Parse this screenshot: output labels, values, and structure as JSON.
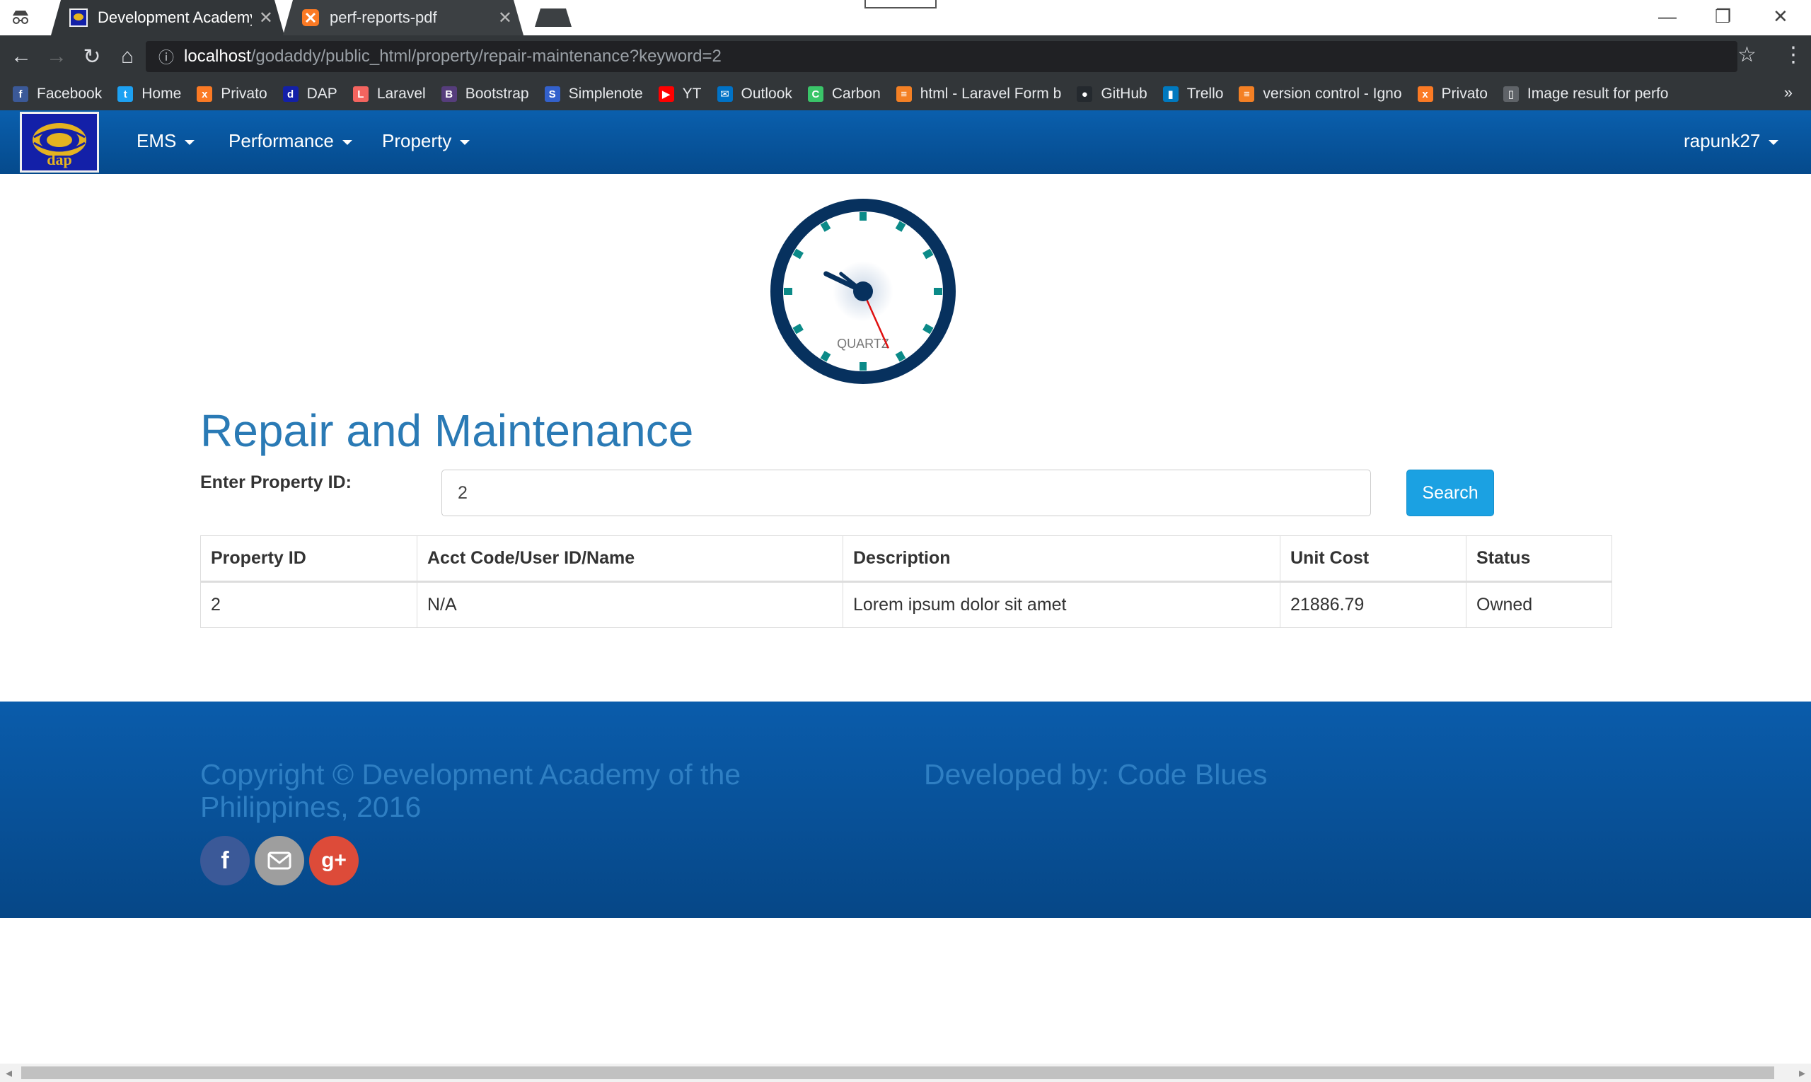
{
  "browser": {
    "tabs": [
      {
        "title": "Development Academy of the Philippines",
        "active": true
      },
      {
        "title": "perf-reports-pdf",
        "active": false
      }
    ],
    "url_host": "localhost",
    "url_path": "/godaddy/public_html/property/repair-maintenance?keyword=2",
    "bookmarks": [
      {
        "label": "Facebook",
        "icon": "facebook-icon",
        "color": "#3b5998",
        "glyph": "f"
      },
      {
        "label": "Home",
        "icon": "twitter-icon",
        "color": "#1da1f2",
        "glyph": "t"
      },
      {
        "label": "Privato",
        "icon": "xampp-icon",
        "color": "#fb7a24",
        "glyph": "x"
      },
      {
        "label": "DAP",
        "icon": "dap-icon",
        "color": "#1320a8",
        "glyph": "d"
      },
      {
        "label": "Laravel",
        "icon": "laravel-icon",
        "color": "#f4645f",
        "glyph": "L"
      },
      {
        "label": "Bootstrap",
        "icon": "bootstrap-icon",
        "color": "#563d7c",
        "glyph": "B"
      },
      {
        "label": "Simplenote",
        "icon": "simplenote-icon",
        "color": "#3361cc",
        "glyph": "S"
      },
      {
        "label": "YT",
        "icon": "youtube-icon",
        "color": "#ff0000",
        "glyph": "▶"
      },
      {
        "label": "Outlook",
        "icon": "outlook-icon",
        "color": "#0072c6",
        "glyph": "✉"
      },
      {
        "label": "Carbon",
        "icon": "carbon-icon",
        "color": "#3ac569",
        "glyph": "C"
      },
      {
        "label": "html - Laravel Form b",
        "icon": "stackoverflow-icon",
        "color": "#f48024",
        "glyph": "≡"
      },
      {
        "label": "GitHub",
        "icon": "github-icon",
        "color": "#24292e",
        "glyph": "●"
      },
      {
        "label": "Trello",
        "icon": "trello-icon",
        "color": "#0079bf",
        "glyph": "▮"
      },
      {
        "label": "version control - Igno",
        "icon": "stackoverflow-icon",
        "color": "#f48024",
        "glyph": "≡"
      },
      {
        "label": "Privato",
        "icon": "xampp-icon",
        "color": "#fb7a24",
        "glyph": "x"
      },
      {
        "label": "Image result for perfo",
        "icon": "page-icon",
        "color": "#5f6368",
        "glyph": "▯"
      }
    ]
  },
  "navbar": {
    "logo_text": "DAP",
    "items": [
      {
        "label": "EMS"
      },
      {
        "label": "Performance"
      },
      {
        "label": "Property"
      }
    ],
    "user": "rapunk27"
  },
  "clock": {
    "brand": "QUARTZ",
    "hour": 9,
    "minute": 51,
    "second": 26
  },
  "main": {
    "title": "Repair and Maintenance",
    "label": "Enter Property ID:",
    "input_value": "2",
    "search_label": "Search",
    "table": {
      "headers": [
        "Property ID",
        "Acct Code/User ID/Name",
        "Description",
        "Unit Cost",
        "Status"
      ],
      "rows": [
        [
          "2",
          "N/A",
          "Lorem ipsum dolor sit amet",
          "21886.79",
          "Owned"
        ]
      ]
    }
  },
  "footer": {
    "copyright": "Copyright © Development Academy of the Philippines, 2016",
    "developed_by": "Developed by: Code Blues",
    "social": [
      {
        "name": "facebook",
        "color": "#3b5998"
      },
      {
        "name": "email",
        "color": "#9e9e9e"
      },
      {
        "name": "google-plus",
        "color": "#dd4b39"
      }
    ]
  },
  "colors": {
    "navbar": "#0a5fad",
    "title": "#2a7ab5",
    "button": "#1ba1e2",
    "footer_text": "#2f7fc3"
  }
}
